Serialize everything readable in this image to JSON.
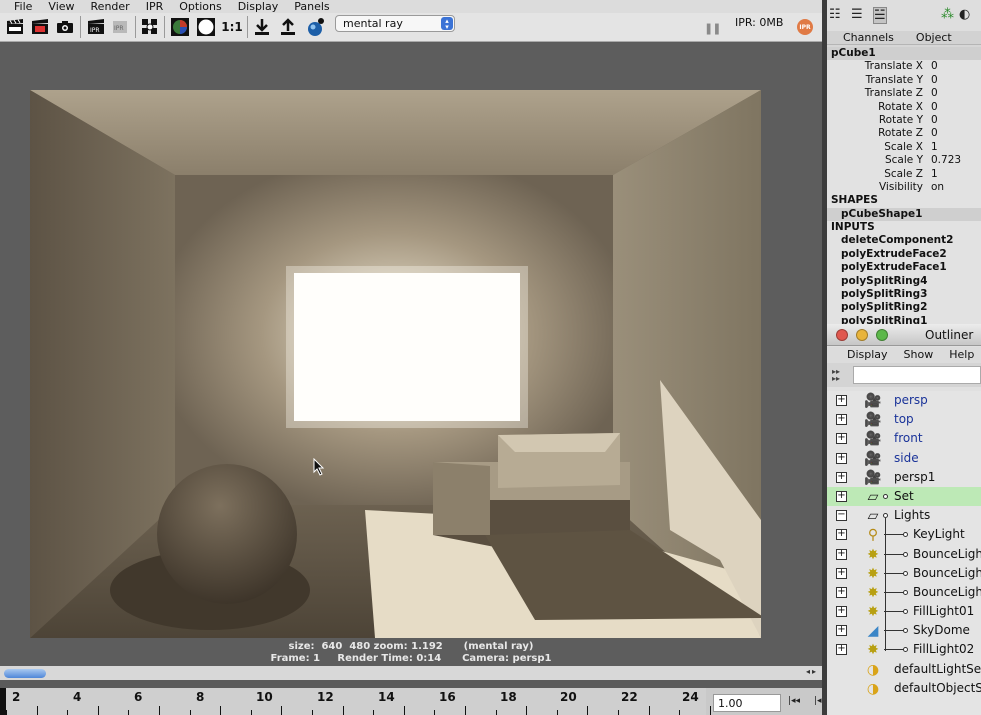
{
  "render_view": {
    "menu": [
      "File",
      "View",
      "Render",
      "IPR",
      "Options",
      "Display",
      "Panels"
    ],
    "toolbar": {
      "ratio_label": "1:1",
      "renderer": "mental ray",
      "ipr_memory": "IPR: 0MB",
      "ipr_badge": "IPR"
    },
    "render_info": {
      "line1": "size:  640  480 zoom: 1.192      (mental ray)",
      "line2": "Frame: 1     Render Time: 0:14      Camera: persp1"
    }
  },
  "timeline": {
    "frame_labels": [
      "2",
      "4",
      "6",
      "8",
      "10",
      "12",
      "14",
      "16",
      "18",
      "20",
      "22",
      "24"
    ],
    "current_time": "1.00"
  },
  "channel_box": {
    "tabs": [
      "Channels",
      "Object"
    ],
    "object_name": "pCube1",
    "attributes": [
      {
        "name": "Translate X",
        "value": "0"
      },
      {
        "name": "Translate Y",
        "value": "0"
      },
      {
        "name": "Translate Z",
        "value": "0"
      },
      {
        "name": "Rotate X",
        "value": "0"
      },
      {
        "name": "Rotate Y",
        "value": "0"
      },
      {
        "name": "Rotate Z",
        "value": "0"
      },
      {
        "name": "Scale X",
        "value": "1"
      },
      {
        "name": "Scale Y",
        "value": "0.723"
      },
      {
        "name": "Scale Z",
        "value": "1"
      },
      {
        "name": "Visibility",
        "value": "on"
      }
    ],
    "shapes_header": "SHAPES",
    "shape_name": "pCubeShape1",
    "inputs_header": "INPUTS",
    "inputs": [
      "deleteComponent2",
      "polyExtrudeFace2",
      "polyExtrudeFace1",
      "polySplitRing4",
      "polySplitRing3",
      "polySplitRing2",
      "polySplitRing1"
    ]
  },
  "outliner": {
    "title": "Outliner",
    "menu": [
      "Display",
      "Show",
      "Help"
    ],
    "items": [
      {
        "label": "persp",
        "icon": "camera-icon",
        "kind": "camera",
        "expand": "+"
      },
      {
        "label": "top",
        "icon": "camera-icon",
        "kind": "camera",
        "expand": "+"
      },
      {
        "label": "front",
        "icon": "camera-icon",
        "kind": "camera",
        "expand": "+"
      },
      {
        "label": "side",
        "icon": "camera-icon",
        "kind": "camera",
        "expand": "+"
      },
      {
        "label": "persp1",
        "icon": "camera-icon",
        "kind": "object",
        "expand": "+"
      },
      {
        "label": "Set",
        "icon": "set-icon",
        "kind": "object",
        "expand": "+",
        "selected": true
      },
      {
        "label": "Lights",
        "icon": "set-icon",
        "kind": "object",
        "expand": "−"
      },
      {
        "label": "KeyLight",
        "icon": "spotlight-icon",
        "kind": "child",
        "expand": "+"
      },
      {
        "label": "BounceLight",
        "icon": "arealight-icon",
        "kind": "child",
        "expand": "+"
      },
      {
        "label": "BounceLight",
        "icon": "arealight-icon",
        "kind": "child",
        "expand": "+"
      },
      {
        "label": "BounceLight",
        "icon": "arealight-icon",
        "kind": "child",
        "expand": "+"
      },
      {
        "label": "FillLight01",
        "icon": "arealight-icon",
        "kind": "child",
        "expand": "+"
      },
      {
        "label": "SkyDome",
        "icon": "skydome-icon",
        "kind": "child",
        "expand": "+"
      },
      {
        "label": "FillLight02",
        "icon": "arealight-icon",
        "kind": "child",
        "expand": "+"
      },
      {
        "label": "defaultLightSet",
        "icon": "lightset-icon",
        "kind": "object",
        "expand": ""
      },
      {
        "label": "defaultObjectSet",
        "icon": "lightset-icon",
        "kind": "object",
        "expand": ""
      }
    ]
  },
  "colors": {
    "outliner_selected": "#bde9b6",
    "camera_label": "#1a3399"
  }
}
